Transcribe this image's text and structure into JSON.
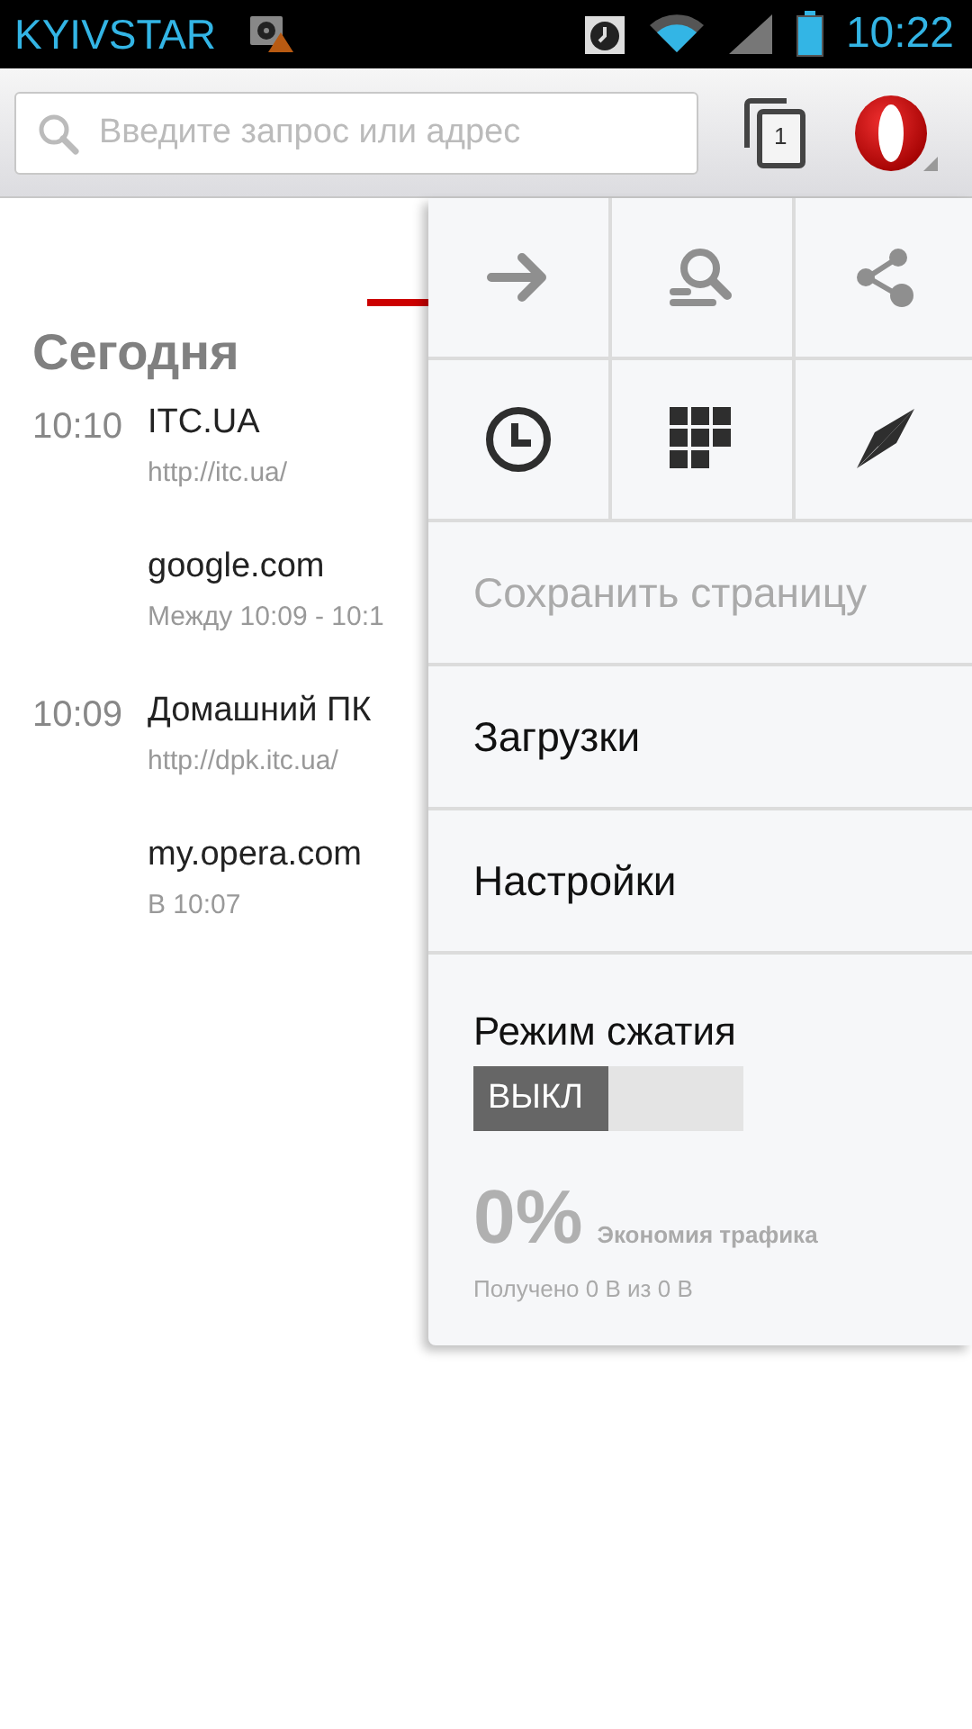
{
  "status_bar": {
    "carrier": "KYIVSTAR",
    "time": "10:22"
  },
  "toolbar": {
    "search": {
      "placeholder": "Введите запрос или адрес"
    },
    "tab_count": "1"
  },
  "tabs": [
    {
      "selected": true
    }
  ],
  "history": {
    "heading": "Сегодня",
    "entries": [
      {
        "time": "10:10",
        "title": "ITC.UA",
        "subtitle": "http://itc.ua/"
      },
      {
        "title": "google.com",
        "subtitle": "Между 10:09 - 10:1"
      },
      {
        "time": "10:09",
        "title": "Домашний ПК",
        "subtitle": "http://dpk.itc.ua/"
      },
      {
        "title": "my.opera.com",
        "subtitle": "В 10:07"
      }
    ]
  },
  "menu": {
    "grid": [
      {
        "kind": "forward",
        "disabled": true
      },
      {
        "kind": "find",
        "disabled": true
      },
      {
        "kind": "share",
        "disabled": true
      },
      {
        "kind": "history",
        "disabled": false
      },
      {
        "kind": "speed-dial",
        "disabled": false
      },
      {
        "kind": "discover",
        "disabled": false
      }
    ],
    "items": [
      {
        "label": "Сохранить страницу",
        "disabled": true
      },
      {
        "label": "Загрузки",
        "disabled": false
      },
      {
        "label": "Настройки",
        "disabled": false
      }
    ],
    "compression": {
      "label": "Режим сжатия",
      "state_label": "ВЫКЛ",
      "on": false,
      "percent": "0%",
      "savings_label": "Экономия трафика",
      "received": "Получено 0 В из 0 В"
    }
  }
}
